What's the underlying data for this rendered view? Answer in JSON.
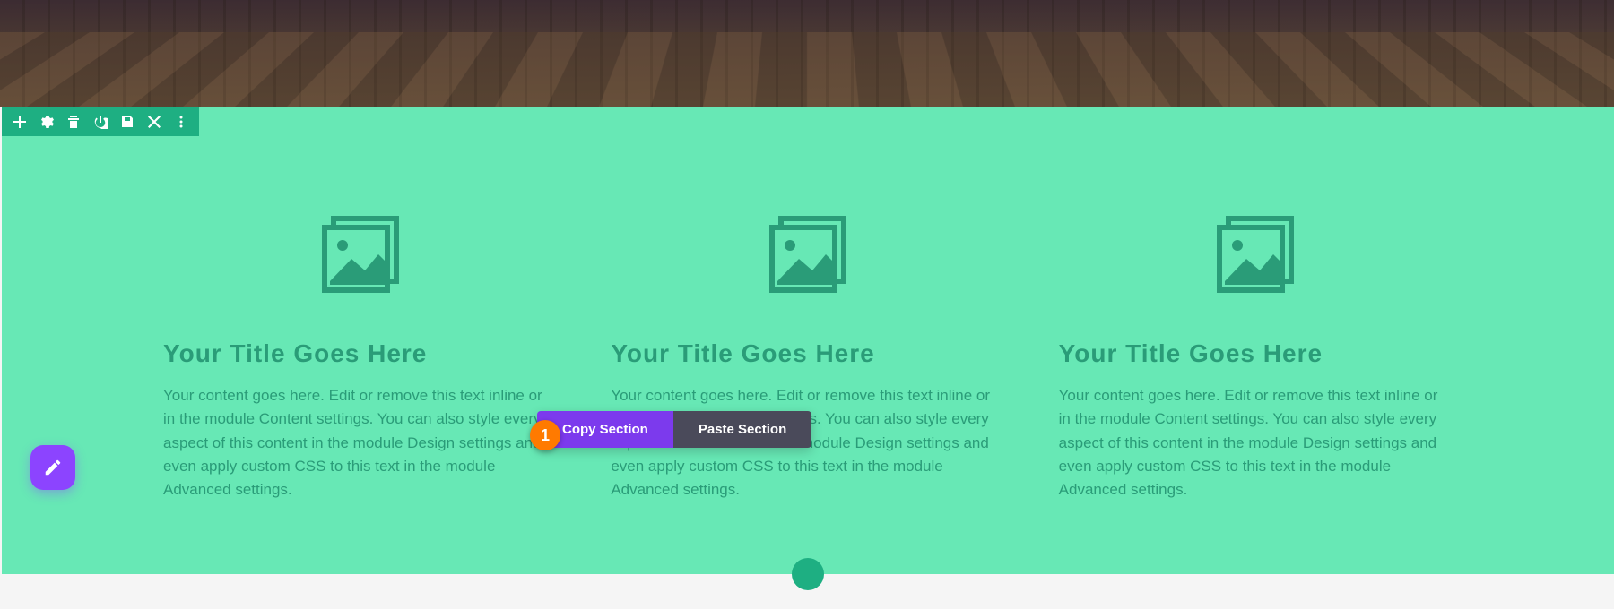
{
  "hero": {},
  "section": {
    "columns": [
      {
        "title": "Your Title Goes Here",
        "text": "Your content goes here. Edit or remove this text inline or in the module Content settings. You can also style every aspect of this content in the module Design settings and even apply custom CSS to this text in the module Advanced settings."
      },
      {
        "title": "Your Title Goes Here",
        "text": "Your content goes here. Edit or remove this text inline or in the module Content settings. You can also style every aspect of this content in the module Design settings and even apply custom CSS to this text in the module Advanced settings."
      },
      {
        "title": "Your Title Goes Here",
        "text": "Your content goes here. Edit or remove this text inline or in the module Content settings. You can also style every aspect of this content in the module Design settings and even apply custom CSS to this text in the module Advanced settings."
      }
    ]
  },
  "context_menu": {
    "copy_label": "Copy Section",
    "paste_label": "Paste Section"
  },
  "callout": {
    "number": "1"
  },
  "colors": {
    "section_bg": "#67e8b5",
    "toolbar_bg": "#1eaf82",
    "text_color": "#2a9c78",
    "copy_bg": "#7c3aed",
    "paste_bg": "#4a4a5a",
    "callout_bg": "#ff7a00",
    "fab_bg": "#8c44ff"
  }
}
